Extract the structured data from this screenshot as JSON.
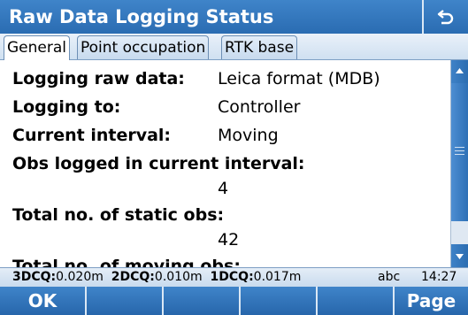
{
  "window": {
    "title": "Raw Data Logging Status",
    "back_icon": "return-arrow-icon"
  },
  "tabs": [
    {
      "label": "General",
      "active": true
    },
    {
      "label": "Point occupation",
      "active": false
    },
    {
      "label": "RTK base",
      "active": false
    }
  ],
  "fields": {
    "logging_raw_data": {
      "label": "Logging raw data:",
      "value": "Leica format (MDB)"
    },
    "logging_to": {
      "label": "Logging to:",
      "value": "Controller"
    },
    "current_interval": {
      "label": "Current interval:",
      "value": "Moving"
    },
    "obs_logged": {
      "label": "Obs logged in current interval:",
      "value": "4"
    },
    "total_static": {
      "label": "Total no. of static obs:",
      "value": "42"
    },
    "total_moving": {
      "label": "Total no. of moving obs:"
    }
  },
  "status_bar": {
    "dcq3_label": "3DCQ:",
    "dcq3_value": "0.020m",
    "dcq2_label": "2DCQ:",
    "dcq2_value": "0.010m",
    "dcq1_label": "1DCQ:",
    "dcq1_value": "0.017m",
    "input_mode": "abc",
    "time": "14:27"
  },
  "function_keys": {
    "f1": "OK",
    "f2": "",
    "f3": "",
    "f4": "",
    "f5": "",
    "f6": "Page"
  },
  "colors": {
    "titlebar": "#2f74ba",
    "accent": "#2c6db1"
  }
}
